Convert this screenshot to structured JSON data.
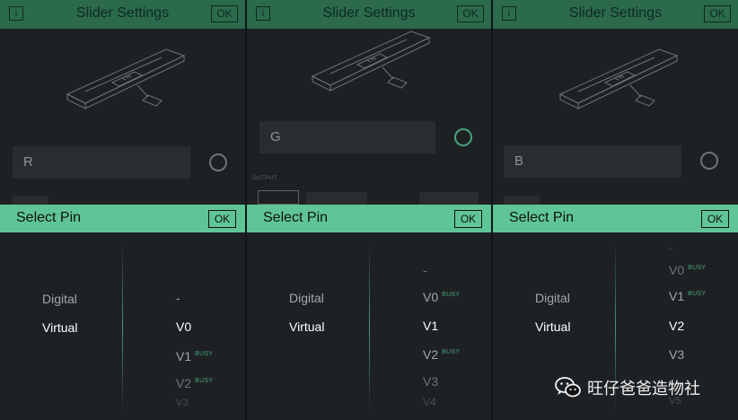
{
  "panels": [
    {
      "header": {
        "info_label": "i",
        "title": "Slider Settings",
        "ok_label": "OK"
      },
      "pin_field_label": "R",
      "sheet": {
        "title": "Select Pin",
        "ok_label": "OK",
        "types": [
          "Digital",
          "Virtual"
        ],
        "selected_type": "Virtual",
        "pins": [
          {
            "label": "-",
            "busy": ""
          },
          {
            "label": "V0",
            "busy": "",
            "selected": true
          },
          {
            "label": "V1",
            "busy": "BUSY"
          },
          {
            "label": "V2",
            "busy": "BUSY"
          },
          {
            "label": "V3",
            "busy": ""
          }
        ]
      }
    },
    {
      "header": {
        "info_label": "i",
        "title": "Slider Settings",
        "ok_label": "OK"
      },
      "pin_field_label": "G",
      "output_label": "OUTPUT",
      "sheet": {
        "title": "Select Pin",
        "ok_label": "OK",
        "types": [
          "Digital",
          "Virtual"
        ],
        "selected_type": "Virtual",
        "pins": [
          {
            "label": "-",
            "busy": ""
          },
          {
            "label": "V0",
            "busy": "BUSY"
          },
          {
            "label": "V1",
            "busy": "",
            "selected": true
          },
          {
            "label": "V2",
            "busy": "BUSY"
          },
          {
            "label": "V3",
            "busy": ""
          },
          {
            "label": "V4",
            "busy": ""
          }
        ]
      }
    },
    {
      "header": {
        "info_label": "i",
        "title": "Slider Settings",
        "ok_label": "OK"
      },
      "pin_field_label": "B",
      "sheet": {
        "title": "Select Pin",
        "ok_label": "OK",
        "types": [
          "Digital",
          "Virtual"
        ],
        "selected_type": "Virtual",
        "pins": [
          {
            "label": "-",
            "busy": ""
          },
          {
            "label": "V0",
            "busy": "BUSY"
          },
          {
            "label": "V1",
            "busy": "BUSY"
          },
          {
            "label": "V2",
            "busy": "",
            "selected": true
          },
          {
            "label": "V3",
            "busy": ""
          },
          {
            "label": "V5",
            "busy": ""
          }
        ]
      }
    }
  ],
  "watermark": {
    "text": "旺仔爸爸造物社",
    "icon": "wechat-icon"
  },
  "colors": {
    "header_dim": "#2b6a4c",
    "sheet_header": "#5fc596",
    "panel_bg": "#1e2124",
    "busy": "#49a27c"
  }
}
